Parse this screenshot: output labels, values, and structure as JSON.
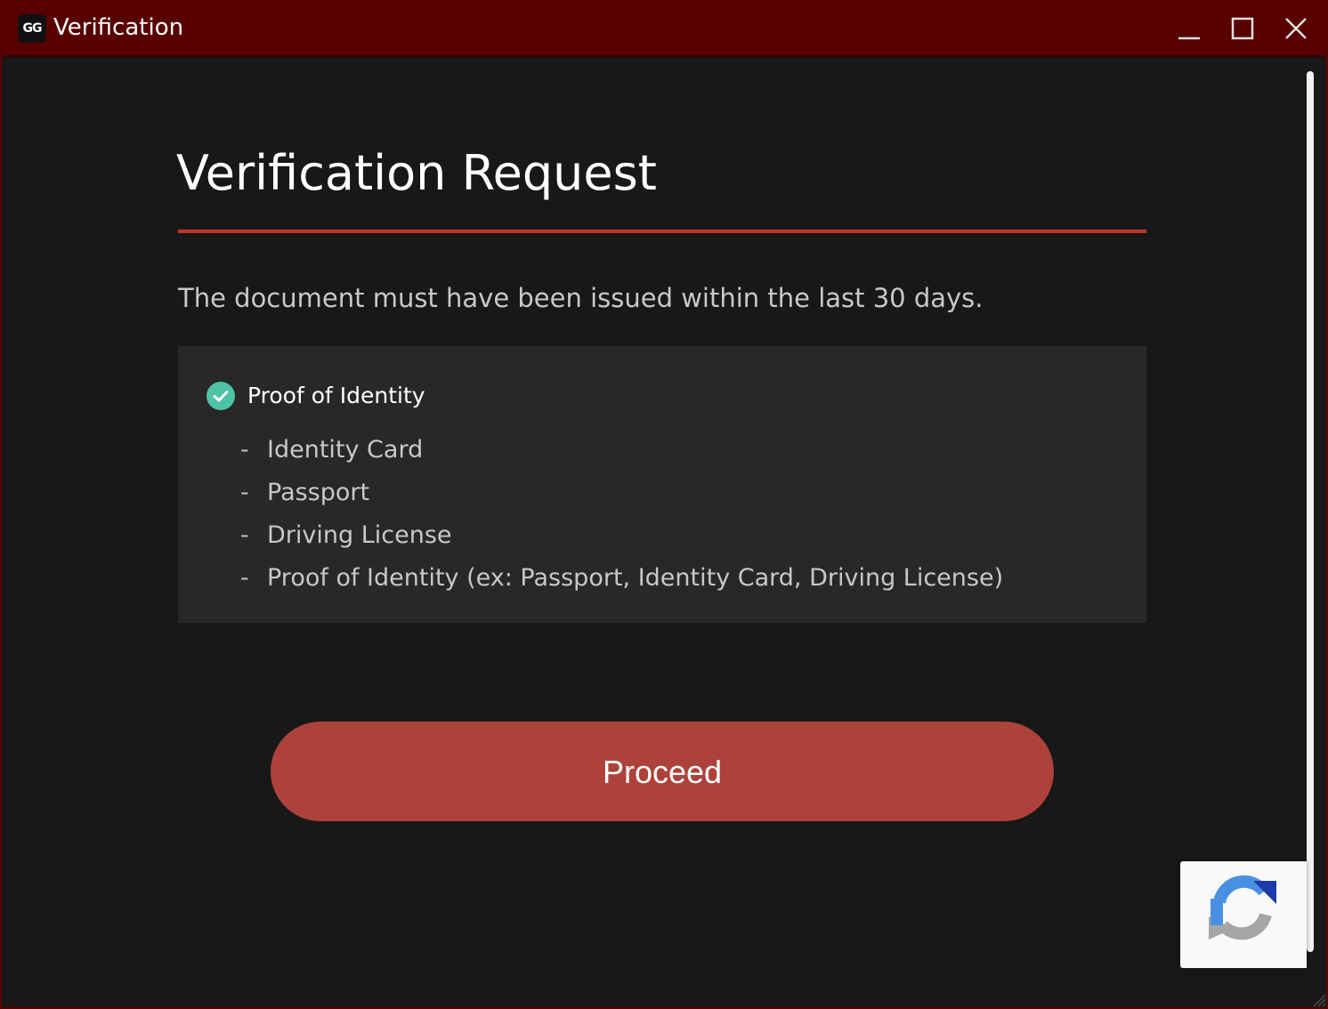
{
  "window": {
    "logo_text": "GG",
    "title": "Verification"
  },
  "page": {
    "heading": "Verification Request",
    "notice": "The document must have been issued within the last 30 days."
  },
  "documents": {
    "title": "Proof of Identity",
    "items": [
      {
        "dash": "-",
        "label": "Identity Card"
      },
      {
        "dash": "-",
        "label": "Passport"
      },
      {
        "dash": "-",
        "label": "Driving License"
      },
      {
        "dash": "-",
        "label": "Proof of Identity (ex: Passport, Identity Card, Driving License)"
      }
    ]
  },
  "actions": {
    "proceed_label": "Proceed"
  },
  "icons": {
    "logo": "gg-logo-icon",
    "minimize": "minimize-icon",
    "maximize": "maximize-icon",
    "close": "close-icon",
    "check": "check-circle-icon",
    "recaptcha": "recaptcha-icon"
  },
  "colors": {
    "titlebar": "#580000",
    "accent": "#c0392b",
    "button": "#ad423b",
    "check": "#4ec3a5",
    "background": "#181818",
    "panel": "#282828"
  }
}
